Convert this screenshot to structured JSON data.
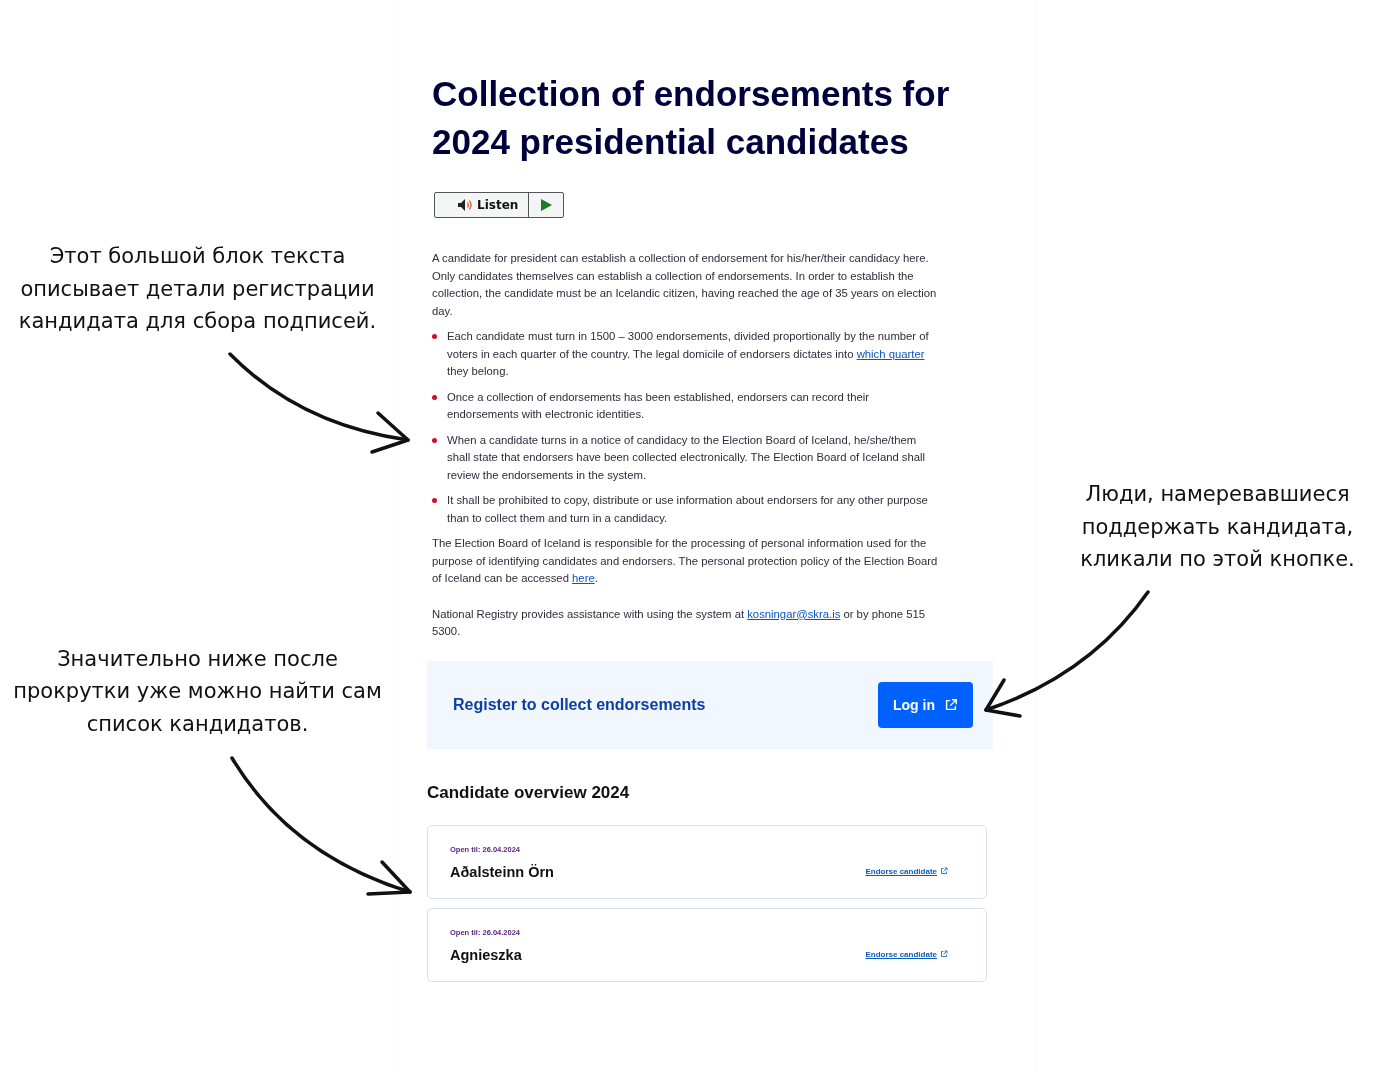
{
  "left_notes": [
    {
      "text": "Этот большой блок текста описывает детали регистрации кандидата для сбора подписей."
    },
    {
      "text": "Значительно ниже после прокрутки уже можно найти сам список кандидатов."
    }
  ],
  "right_notes": [
    {
      "text": "Люди, намеревавшиеся поддержать кандидата, кликали по этой кнопке."
    }
  ],
  "page": {
    "title": "Collection of endorsements for 2024 presidential candidates",
    "listen": {
      "label": "Listen"
    },
    "intro": [
      {
        "text": "A candidate for president can establish a collection of endorsement for his/her/their candidacy here. Only candidates themselves can establish a collection of endorsements. In order to establish the collection, the candidate must be an Icelandic citizen, having reached the age of 35 years on election day."
      }
    ],
    "bullets": [
      [
        {
          "text": "Each candidate must turn in 1500 – 3000 endorsements, divided proportionally by the number of voters in each quarter of the country. The legal domicile of endorsers dictates into "
        },
        {
          "link": "which quarter"
        },
        {
          "text": " they belong."
        }
      ],
      [
        {
          "text": "Once a collection of endorsements has been established, endorsers can record their endorsements with electronic identities."
        }
      ],
      [
        {
          "text": "When a candidate turns in a notice of candidacy to the Election Board of Iceland, he/she/them shall state that endorsers have been collected electronically. The Election Board of Iceland shall review the endorsements in the system."
        }
      ],
      [
        {
          "text": "It shall be prohibited to copy, distribute or use information about endorsers for any other purpose than to collect them and turn in a candidacy."
        }
      ]
    ],
    "paragraphs": [
      [
        {
          "text": "The Election Board of Iceland is responsible for the processing of personal information used for the purpose of identifying candidates and endorsers. The personal protection policy of the Election Board of Iceland can be accessed "
        },
        {
          "link": "here"
        },
        {
          "text": "."
        }
      ],
      [
        {
          "text": "National Registry provides assistance with using the system at "
        },
        {
          "link": "kosningar@skra.is"
        },
        {
          "text": " or by phone 515 5300."
        }
      ]
    ],
    "register": {
      "heading": "Register to collect endorsements",
      "button": "Log in"
    },
    "overview": {
      "heading": "Candidate overview 2024",
      "candidates": [
        {
          "open_til": "Open til: 26.04.2024",
          "name": "Aðalsteinn Örn",
          "action": "Endorse candidate"
        },
        {
          "open_til": "Open til: 26.04.2024",
          "name": "Agnieszka",
          "action": "Endorse candidate"
        }
      ]
    }
  }
}
